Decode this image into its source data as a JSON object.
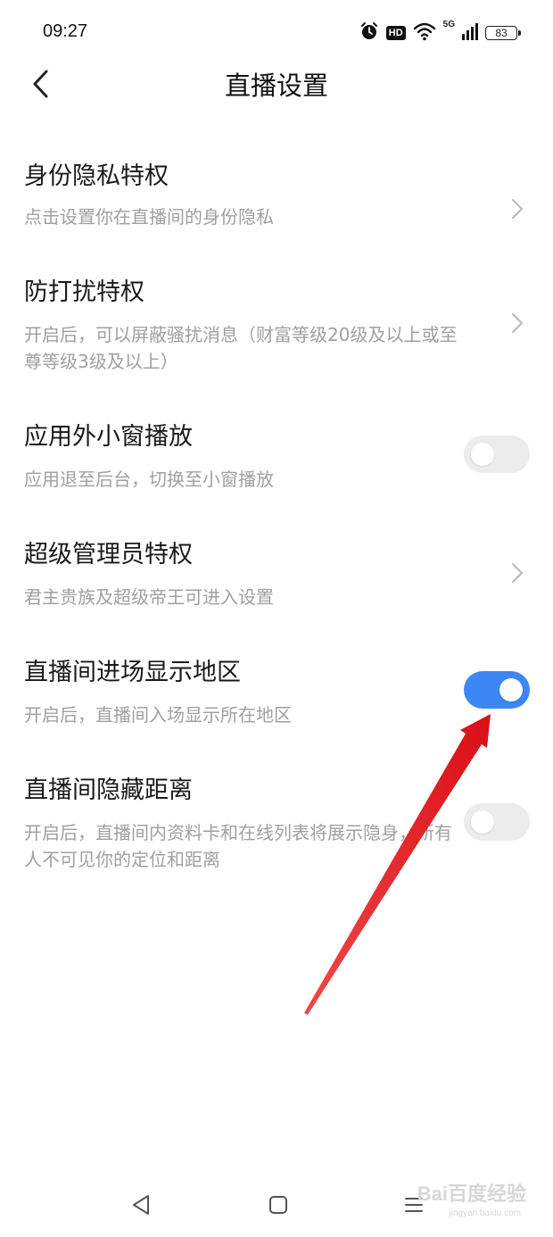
{
  "status_bar": {
    "time": "09:27",
    "network": "5G",
    "battery": "83",
    "icons": [
      "alarm-icon",
      "hd-icon",
      "wifi-icon",
      "signal-icon",
      "battery-icon"
    ]
  },
  "header": {
    "title": "直播设置",
    "back_icon": "chevron-left-icon"
  },
  "settings": [
    {
      "title": "身份隐私特权",
      "desc": "点击设置你在直播间的身份隐私",
      "control": "chevron"
    },
    {
      "title": "防打扰特权",
      "desc": "开启后，可以屏蔽骚扰消息（财富等级20级及以上或至尊等级3级及以上）",
      "control": "chevron"
    },
    {
      "title": "应用外小窗播放",
      "desc": "应用退至后台，切换至小窗播放",
      "control": "toggle",
      "toggle_on": false
    },
    {
      "title": "超级管理员特权",
      "desc": "君主贵族及超级帝王可进入设置",
      "control": "chevron"
    },
    {
      "title": "直播间进场显示地区",
      "desc": "开启后，直播间入场显示所在地区",
      "control": "toggle",
      "toggle_on": true
    },
    {
      "title": "直播间隐藏距离",
      "desc": "开启后，直播间内资料卡和在线列表将展示隐身，所有人不可见你的定位和距离",
      "control": "toggle",
      "toggle_on": false
    }
  ],
  "nav": {
    "icons": [
      "back-triangle-icon",
      "home-square-icon",
      "menu-lines-icon"
    ]
  },
  "watermark": {
    "text": "Bai百度经验",
    "sub": "jingyan.baidu.com"
  },
  "colors": {
    "accent": "#3d86f6",
    "toggle_off": "#ececec",
    "annotation_arrow": "#e8141b",
    "desc_text": "#a0a0a0"
  }
}
